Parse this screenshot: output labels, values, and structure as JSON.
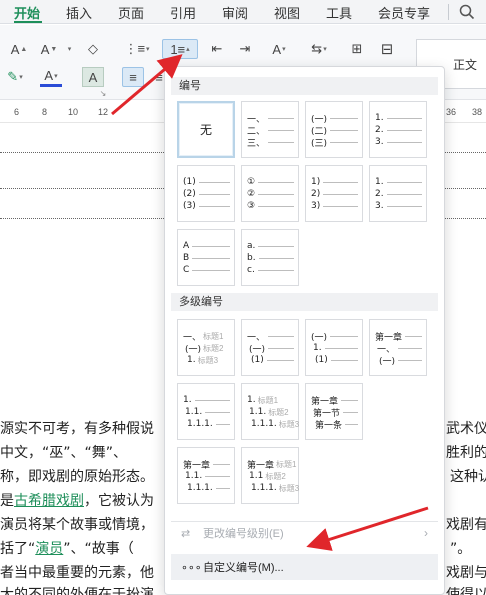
{
  "menubar": {
    "tabs": [
      "开始",
      "插入",
      "页面",
      "引用",
      "审阅",
      "视图",
      "工具",
      "会员专享"
    ],
    "active_index": 0
  },
  "ribbon": {
    "row1": [
      "A",
      "A",
      "◇",
      "⋮≡",
      "1≡",
      "⇤",
      "⇥",
      "A",
      "⇆",
      "⊞"
    ],
    "row2": [
      "A",
      "A",
      "A",
      "≡",
      "≡"
    ],
    "style_label": "正文"
  },
  "ruler": [
    "6",
    "8",
    "10",
    "12",
    "36",
    "38"
  ],
  "document": {
    "lines": [
      {
        "text": "源实不可考，有多种假说"
      },
      {
        "text": "中文，“巫”、“舞”、"
      },
      {
        "text": "称，即戏剧的原始形态。"
      },
      {
        "pre": "是",
        "link": "古希腊戏剧",
        "post": "，它被认为"
      },
      {
        "text": "演员将某个故事或情境，"
      },
      {
        "pre": "括了“",
        "link": "演员",
        "post": "”、“故事（"
      },
      {
        "text": "者当中最重要的元素，他"
      },
      {
        "text": "大的不同的外便在于扮演"
      }
    ],
    "right_lines": [
      "武术仪",
      "胜利的巫",
      "这种认",
      "戏剧有四",
      "”。",
      "戏剧与其",
      "使得以他"
    ]
  },
  "dropdown": {
    "section_numbering": "编号",
    "section_multilevel": "多级编号",
    "none_label": "无",
    "cells": [
      [
        "一、",
        "二、",
        "三、"
      ],
      [
        "(一)",
        "(二)",
        "(三)"
      ],
      [
        "1.",
        "2.",
        "3."
      ],
      [
        "(1)",
        "(2)",
        "(3)"
      ],
      [
        "①",
        "②",
        "③"
      ],
      [
        "1)",
        "2)",
        "3)"
      ],
      [
        "1.",
        "2.",
        "3."
      ],
      [
        "A",
        "B",
        "C"
      ],
      [
        "a.",
        "b.",
        "c."
      ]
    ],
    "multilevel": [
      [
        {
          "m": "一、",
          "h": "标题1"
        },
        {
          "m": "(一)",
          "h": "标题2"
        },
        {
          "m": "1.",
          "h": "标题3"
        }
      ],
      [
        {
          "m": "一、",
          "h": ""
        },
        {
          "m": "(一)",
          "h": ""
        },
        {
          "m": "(1)",
          "h": ""
        }
      ],
      [
        {
          "m": "(一)",
          "h": ""
        },
        {
          "m": "1.",
          "h": ""
        },
        {
          "m": "(1)",
          "h": ""
        }
      ],
      [
        {
          "m": "第一章",
          "h": ""
        },
        {
          "m": "一、",
          "h": ""
        },
        {
          "m": "(一)",
          "h": ""
        }
      ],
      [
        {
          "m": "1.",
          "h": ""
        },
        {
          "m": "1.1.",
          "h": ""
        },
        {
          "m": "1.1.1.",
          "h": ""
        }
      ],
      [
        {
          "m": "1.",
          "h": "标题1"
        },
        {
          "m": "1.1.",
          "h": "标题2"
        },
        {
          "m": "1.1.1.",
          "h": "标题3"
        }
      ],
      [
        {
          "m": "第一章",
          "h": ""
        },
        {
          "m": "第一节",
          "h": ""
        },
        {
          "m": "第一条",
          "h": ""
        }
      ],
      [
        {
          "m": "第一章",
          "h": ""
        },
        {
          "m": "1.1.",
          "h": ""
        },
        {
          "m": "1.1.1.",
          "h": ""
        }
      ],
      [
        {
          "m": "第一章",
          "h": "标题1"
        },
        {
          "m": "1.1",
          "h": "标题2"
        },
        {
          "m": "1.1.1.",
          "h": "标题3"
        }
      ]
    ],
    "change_level": "更改编号级别(E)",
    "custom": "自定义编号(M)...",
    "custom_icon": "∘∘∘"
  },
  "colors": {
    "accent": "#1e8f5a",
    "arrow": "#e0262b"
  }
}
